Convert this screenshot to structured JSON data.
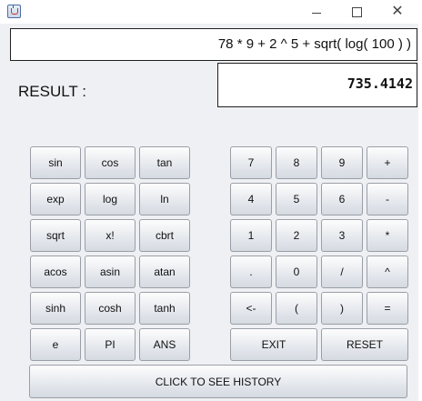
{
  "window": {
    "minimize_icon": "minimize-icon",
    "maximize_icon": "maximize-icon",
    "close_glyph": "✕"
  },
  "display": {
    "expression": "78 * 9 + 2 ^ 5 + sqrt( log( 100 ) )",
    "result_label": "RESULT :",
    "result_value": "735.4142"
  },
  "function_keys": [
    [
      "sin",
      "cos",
      "tan"
    ],
    [
      "exp",
      "log",
      "ln"
    ],
    [
      "sqrt",
      "x!",
      "cbrt"
    ],
    [
      "acos",
      "asin",
      "atan"
    ],
    [
      "sinh",
      "cosh",
      "tanh"
    ],
    [
      "e",
      "PI",
      "ANS"
    ]
  ],
  "number_keys": [
    [
      "7",
      "8",
      "9",
      "+"
    ],
    [
      "4",
      "5",
      "6",
      "-"
    ],
    [
      "1",
      "2",
      "3",
      "*"
    ],
    [
      ".",
      "0",
      "/",
      "^"
    ],
    [
      "<-",
      "(",
      ")",
      "="
    ]
  ],
  "action_keys": {
    "exit": "EXIT",
    "reset": "RESET",
    "history": "CLICK TO SEE HISTORY"
  }
}
